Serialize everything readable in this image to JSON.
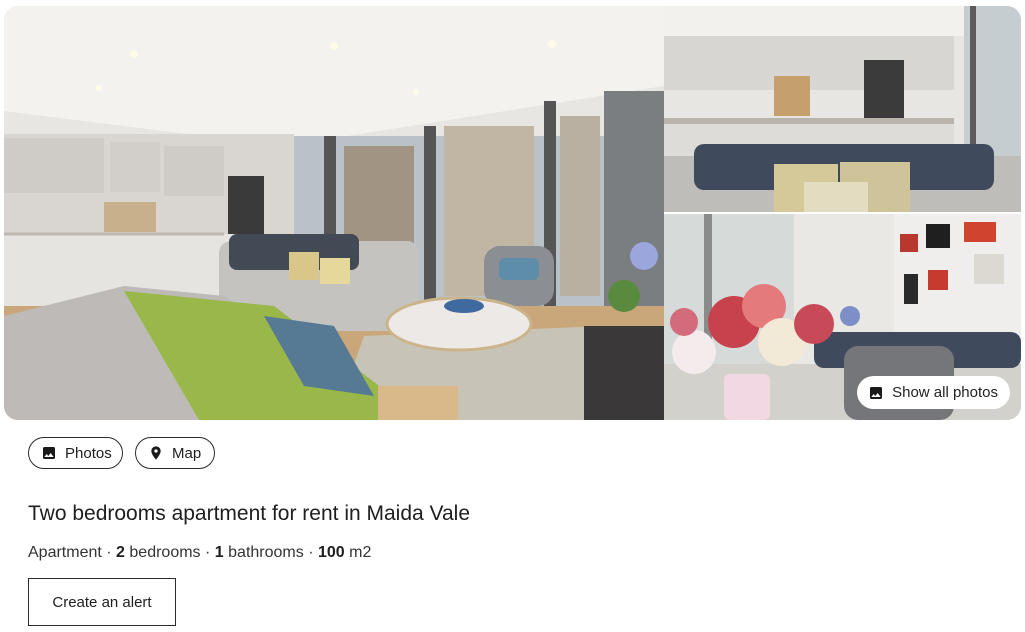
{
  "gallery": {
    "show_all_label": "Show all photos",
    "icons": {
      "show_all": "image-icon"
    }
  },
  "tabs": [
    {
      "label": "Photos",
      "icon": "image-icon"
    },
    {
      "label": "Map",
      "icon": "map-pin-icon"
    }
  ],
  "listing": {
    "title": "Two bedrooms apartment for rent in Maida Vale",
    "property_type": "Apartment",
    "bedrooms": "2",
    "bedrooms_label": "bedrooms",
    "bathrooms": "1",
    "bathrooms_label": "bathrooms",
    "area": "100",
    "area_unit": "m2",
    "separator": "·"
  },
  "alert_button_label": "Create an alert"
}
